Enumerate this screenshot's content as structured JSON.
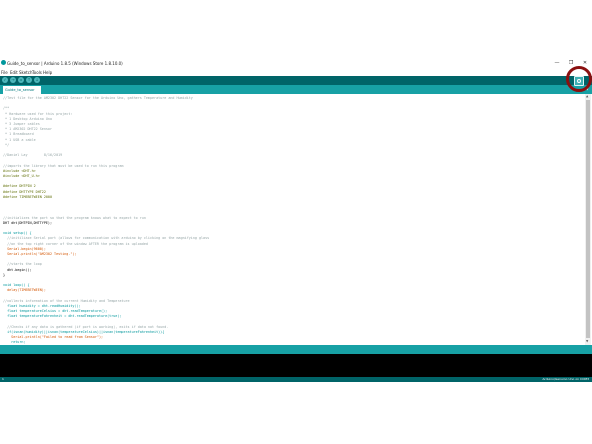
{
  "window": {
    "title": "Guide_to_sensor | Arduino 1.8.5 (Windows Store 1.8.10.0)",
    "minimize": "—",
    "maximize": "❐",
    "close": "✕"
  },
  "menu": {
    "items": [
      "File",
      "Edit",
      "Sketch",
      "Tools",
      "Help"
    ]
  },
  "toolbar": {
    "buttons": [
      "verify-icon",
      "upload-icon",
      "new-icon",
      "open-icon",
      "save-icon"
    ],
    "serial_monitor_icon": "magnifier-icon"
  },
  "tabs": [
    {
      "label": "Guide_to_sensor"
    }
  ],
  "editor": {
    "lines": [
      {
        "text": "//Test file for the AM2302 DHT22 Sensor for the Arduino Uno, gathers Temperature and Humidity",
        "kind": "comment"
      },
      {
        "text": "",
        "kind": "plain"
      },
      {
        "text": "/**",
        "kind": "comment"
      },
      {
        "text": " * Hardware used for this project:",
        "kind": "comment"
      },
      {
        "text": " * 1 Desktop Arduino Uno",
        "kind": "comment"
      },
      {
        "text": " * 3 Jumper cables",
        "kind": "comment"
      },
      {
        "text": " * 1 AM2302 DHT22 Sensor",
        "kind": "comment"
      },
      {
        "text": " * 1 Breadboard",
        "kind": "comment"
      },
      {
        "text": " * 1 USB a cable",
        "kind": "comment"
      },
      {
        "text": " */",
        "kind": "comment"
      },
      {
        "text": "",
        "kind": "plain"
      },
      {
        "text": "//Daniel Lay        8/16/2019",
        "kind": "comment"
      },
      {
        "text": "",
        "kind": "plain"
      },
      {
        "text": "//imports the library that must be used to run this program",
        "kind": "comment"
      },
      {
        "text": "#include <DHT.h>",
        "kind": "directive"
      },
      {
        "text": "#include <DHT_U.h>",
        "kind": "directive"
      },
      {
        "text": "",
        "kind": "plain"
      },
      {
        "text": "#define DHTPIN 2",
        "kind": "directive"
      },
      {
        "text": "#define DHTTYPE DHT22",
        "kind": "directive"
      },
      {
        "text": "#define TIMEBETWEEN 2000",
        "kind": "directive"
      },
      {
        "text": "",
        "kind": "plain"
      },
      {
        "text": "",
        "kind": "plain"
      },
      {
        "text": "",
        "kind": "plain"
      },
      {
        "text": "//initializes the port so that the program knows what to expect to run",
        "kind": "comment"
      },
      {
        "text": "DHT dht(DHTPIN,DHTTYPE);",
        "kind": "plain"
      },
      {
        "text": "",
        "kind": "plain"
      },
      {
        "text": "void setup() {",
        "kind": "keyword"
      },
      {
        "text": "  //initiliaze Serial port (allows for communication with arduino by clicking on the magnifying glass",
        "kind": "comment"
      },
      {
        "text": "  //on the top right corner of the window AFTER the program is uploaded",
        "kind": "comment"
      },
      {
        "text": "  Serial.begin(9600);",
        "kind": "func"
      },
      {
        "text": "  Serial.println(\"AM2302 Testing.\");",
        "kind": "func"
      },
      {
        "text": "",
        "kind": "plain"
      },
      {
        "text": "  //starts the loop",
        "kind": "comment"
      },
      {
        "text": "  dht.begin();",
        "kind": "plain"
      },
      {
        "text": "}",
        "kind": "plain"
      },
      {
        "text": "",
        "kind": "plain"
      },
      {
        "text": "void loop() {",
        "kind": "keyword"
      },
      {
        "text": "  delay(TIMEBETWEEN);",
        "kind": "func"
      },
      {
        "text": "",
        "kind": "plain"
      },
      {
        "text": "//collects information of the current Humidity and Temperature",
        "kind": "comment"
      },
      {
        "text": "  float humidity = dht.readHumidity();",
        "kind": "keyword"
      },
      {
        "text": "  float temperatureCelsius = dht.readTemperature();",
        "kind": "keyword"
      },
      {
        "text": "  float temperatureFahrenheit = dht.readTemperature(true);",
        "kind": "keyword"
      },
      {
        "text": "",
        "kind": "plain"
      },
      {
        "text": "  //Checks if any data is gathered (if port is working), exits if data not found.",
        "kind": "comment"
      },
      {
        "text": "  if(isnan(humidity)||isnan(temperatureCelsius)||isnan(temperatureFahrenheit)){",
        "kind": "keyword"
      },
      {
        "text": "    Serial.println(\"Failed to read from Sensor\");",
        "kind": "func"
      },
      {
        "text": "    return;",
        "kind": "keyword"
      }
    ]
  },
  "footer": {
    "line_number": "1",
    "board": "Arduino/Genuino Uno on COM3"
  },
  "colors": {
    "toolbar": "#006468",
    "tabbar": "#17a1a5",
    "comment": "#95a5a6",
    "keyword": "#00979c",
    "directive": "#5e6d03",
    "func": "#d35400",
    "plain": "#000000",
    "highlight_ring": "#8a1010"
  }
}
